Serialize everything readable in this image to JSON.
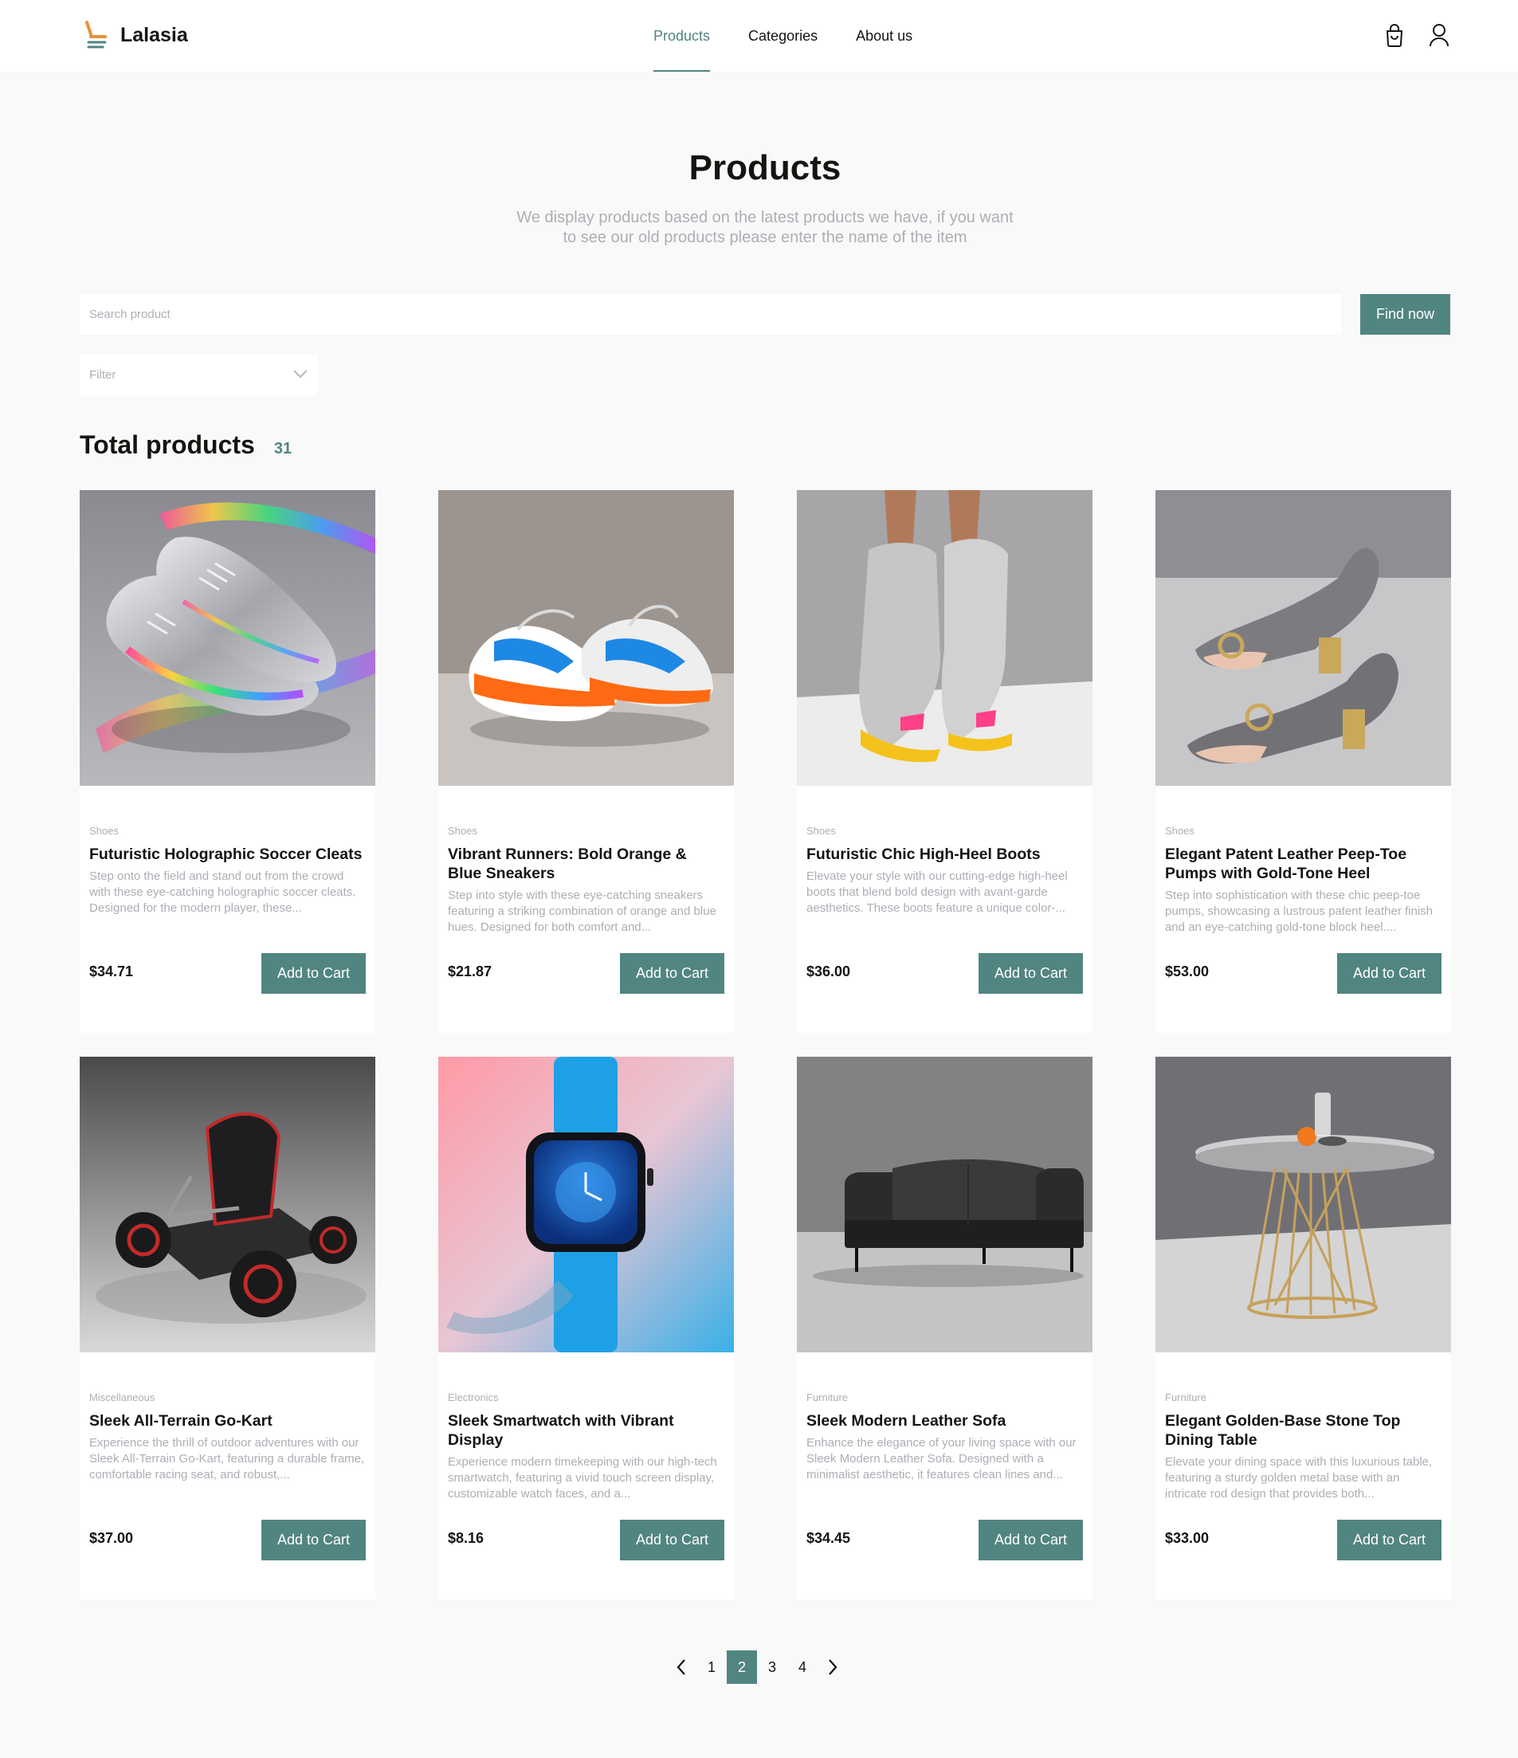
{
  "brand": {
    "name": "Lalasia",
    "accent": "#518581"
  },
  "nav": [
    {
      "label": "Products",
      "active": true
    },
    {
      "label": "Categories",
      "active": false
    },
    {
      "label": "About us",
      "active": false
    }
  ],
  "hero": {
    "title": "Products",
    "subtitle": "We display products based on the latest products we have, if you want to see our old products please enter the name of the item"
  },
  "search": {
    "placeholder": "Search product",
    "value": "",
    "button": "Find now"
  },
  "filter": {
    "placeholder": "Filter"
  },
  "total": {
    "label": "Total products",
    "count": "31"
  },
  "products": [
    {
      "category": "Shoes",
      "title": "Futuristic Holographic Soccer Cleats",
      "description": "Step onto the field and stand out from the crowd with these eye-catching holographic soccer cleats. Designed for the modern player, these...",
      "price": "$34.71",
      "button": "Add to Cart",
      "image": "holographic-cleats"
    },
    {
      "category": "Shoes",
      "title": "Vibrant Runners: Bold Orange & Blue Sneakers",
      "description": "Step into style with these eye-catching sneakers featuring a striking combination of orange and blue hues. Designed for both comfort and...",
      "price": "$21.87",
      "button": "Add to Cart",
      "image": "orange-blue-sneakers"
    },
    {
      "category": "Shoes",
      "title": "Futuristic Chic High-Heel Boots",
      "description": "Elevate your style with our cutting-edge high-heel boots that blend bold design with avant-garde aesthetics. These boots feature a unique color-...",
      "price": "$36.00",
      "button": "Add to Cart",
      "image": "grey-boots"
    },
    {
      "category": "Shoes",
      "title": "Elegant Patent Leather Peep-Toe Pumps with Gold-Tone Heel",
      "description": "Step into sophistication with these chic peep-toe pumps, showcasing a lustrous patent leather finish and an eye-catching gold-tone block heel....",
      "price": "$53.00",
      "button": "Add to Cart",
      "image": "peep-toe-pumps"
    },
    {
      "category": "Miscellaneous",
      "title": "Sleek All-Terrain Go-Kart",
      "description": "Experience the thrill of outdoor adventures with our Sleek All-Terrain Go-Kart, featuring a durable frame, comfortable racing seat, and robust,...",
      "price": "$37.00",
      "button": "Add to Cart",
      "image": "go-kart"
    },
    {
      "category": "Electronics",
      "title": "Sleek Smartwatch with Vibrant Display",
      "description": "Experience modern timekeeping with our high-tech smartwatch, featuring a vivid touch screen display, customizable watch faces, and a...",
      "price": "$8.16",
      "button": "Add to Cart",
      "image": "smartwatch"
    },
    {
      "category": "Furniture",
      "title": "Sleek Modern Leather Sofa",
      "description": "Enhance the elegance of your living space with our Sleek Modern Leather Sofa. Designed with a minimalist aesthetic, it features clean lines and...",
      "price": "$34.45",
      "button": "Add to Cart",
      "image": "leather-sofa"
    },
    {
      "category": "Furniture",
      "title": "Elegant Golden-Base Stone Top Dining Table",
      "description": "Elevate your dining space with this luxurious table, featuring a sturdy golden metal base with an intricate rod design that provides both...",
      "price": "$33.00",
      "button": "Add to Cart",
      "image": "dining-table"
    }
  ],
  "pagination": {
    "pages": [
      "1",
      "2",
      "3",
      "4"
    ],
    "current": "2"
  }
}
